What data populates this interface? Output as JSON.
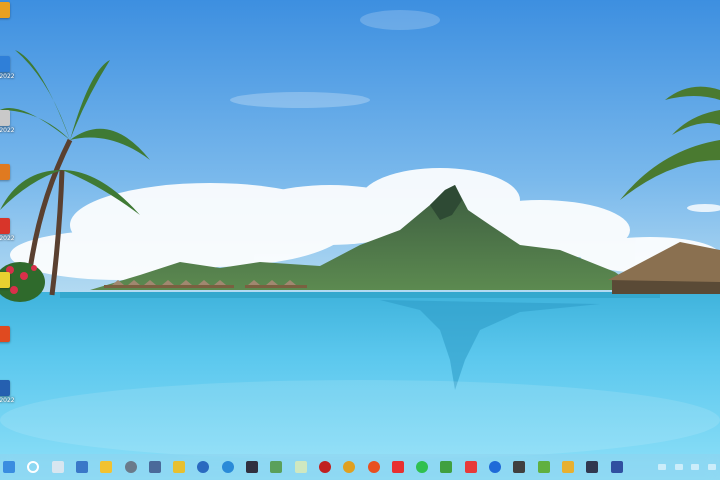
{
  "desktop": {
    "icons": [
      {
        "label": "",
        "color": "#e8a020",
        "name": "desktop-app-1"
      },
      {
        "label": "2022",
        "color": "#2f7fd8",
        "name": "desktop-app-2"
      },
      {
        "label": "2022",
        "color": "#c9c9c9",
        "name": "desktop-app-3"
      },
      {
        "label": "",
        "color": "#e07a20",
        "name": "desktop-app-4"
      },
      {
        "label": "2022",
        "color": "#d8352a",
        "name": "desktop-app-5"
      },
      {
        "label": "",
        "color": "#e8d030",
        "name": "desktop-app-6"
      },
      {
        "label": "",
        "color": "#e04a20",
        "name": "desktop-app-7"
      },
      {
        "label": "2022",
        "color": "#2560b0",
        "name": "desktop-app-8"
      }
    ]
  },
  "taskbar": {
    "icons": [
      {
        "name": "start-icon",
        "color": "#3a8de0"
      },
      {
        "name": "search-icon",
        "color": "#ffffff"
      },
      {
        "name": "widgets-icon",
        "color": "#d8e6f0"
      },
      {
        "name": "desktop-switch-icon",
        "color": "#3a78c8"
      },
      {
        "name": "file-explorer-icon",
        "color": "#f2c230"
      },
      {
        "name": "settings-icon",
        "color": "#6a7a8a"
      },
      {
        "name": "app-icon",
        "color": "#4a6a9a"
      },
      {
        "name": "python-icon",
        "color": "#e8c030"
      },
      {
        "name": "r-icon",
        "color": "#2a6ac0"
      },
      {
        "name": "globe-icon",
        "color": "#2a8ad8"
      },
      {
        "name": "terminal-icon",
        "color": "#303040"
      },
      {
        "name": "photos-icon",
        "color": "#5aa05a"
      },
      {
        "name": "notepad-icon",
        "color": "#cfe8c0"
      },
      {
        "name": "red-app-icon",
        "color": "#c02020"
      },
      {
        "name": "chrome-icon",
        "color": "#e0a020"
      },
      {
        "name": "firefox-icon",
        "color": "#e85020"
      },
      {
        "name": "yandex-icon",
        "color": "#e83030"
      },
      {
        "name": "whatsapp-icon",
        "color": "#30c050"
      },
      {
        "name": "stack-icon",
        "color": "#40a040"
      },
      {
        "name": "anydesk-icon",
        "color": "#e83a3a"
      },
      {
        "name": "teamviewer-icon",
        "color": "#1e6ad8"
      },
      {
        "name": "box-icon",
        "color": "#404040"
      },
      {
        "name": "map-icon",
        "color": "#60b040"
      },
      {
        "name": "folder-icon",
        "color": "#e8b030"
      },
      {
        "name": "shield-icon",
        "color": "#303850"
      },
      {
        "name": "save-icon",
        "color": "#3050a0"
      }
    ]
  },
  "colors": {
    "sky_top": "#4f9fe6",
    "sky_bottom": "#a8d4f0",
    "water": "#6ccff0"
  }
}
